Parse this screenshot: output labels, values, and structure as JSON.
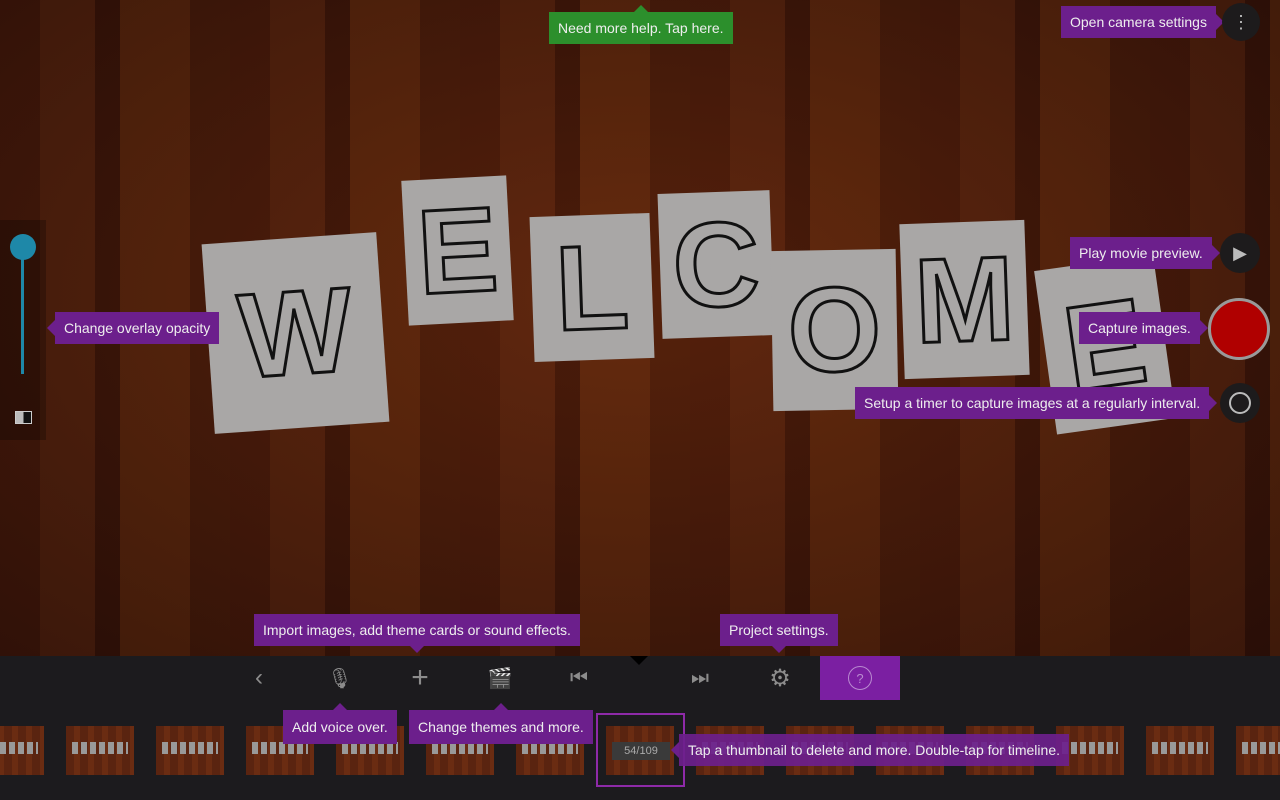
{
  "preview": {
    "letters": [
      "W",
      "E",
      "L",
      "C",
      "O",
      "M",
      "E"
    ]
  },
  "tooltips": {
    "help": "Need more help. Tap here.",
    "camera_settings": "Open camera settings",
    "play": "Play movie preview.",
    "capture": "Capture images.",
    "timer": "Setup a timer to capture images at a regularly interval.",
    "opacity": "Change overlay opacity",
    "import": "Import images, add theme cards or sound effects.",
    "project_settings": "Project settings.",
    "voice": "Add voice over.",
    "themes": "Change themes and more.",
    "thumbnail": "Tap a thumbnail to delete and more. Double-tap for timeline."
  },
  "overlay_opacity": 1.0,
  "timeline": {
    "counter": "54/109",
    "current": 54,
    "total": 109
  },
  "colors": {
    "accent": "#7b1fa2",
    "help": "#2c8f2c",
    "record": "#b00000",
    "slider": "#1e88a8"
  }
}
